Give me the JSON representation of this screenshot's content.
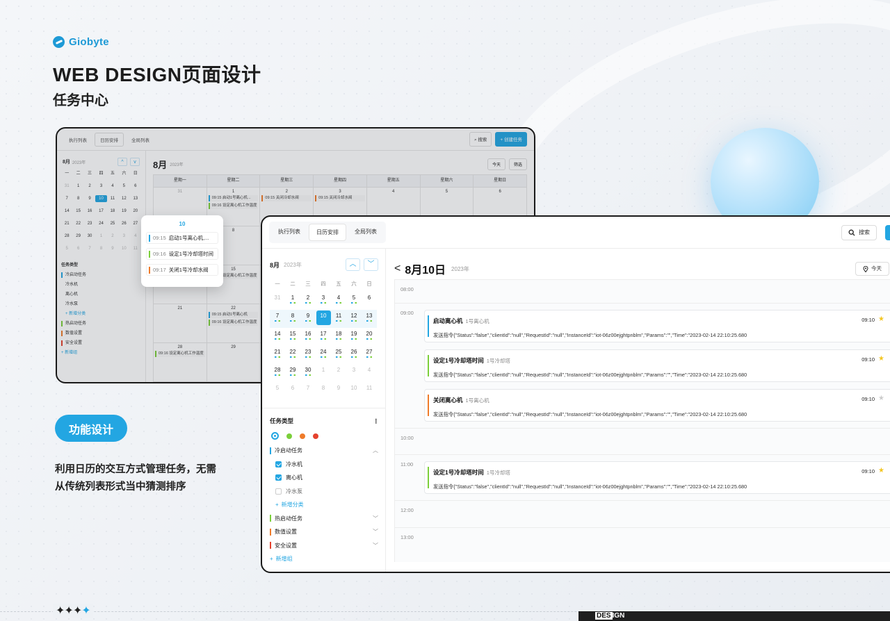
{
  "brand": {
    "name": "Giobyte"
  },
  "header": {
    "title": "WEB DESIGN页面设计",
    "subtitle": "任务中心"
  },
  "feature": {
    "pill": "功能设计",
    "description": "利用日历的交互方式管理任务，无需从传统列表形式当中猜测排序"
  },
  "footer": {
    "stars": "✦✦✦",
    "star_blue": "✦",
    "tag_a": "DES",
    "tag_b": "IGN"
  },
  "colors": {
    "accent": "#23a6e2",
    "green": "#7bcf3a",
    "orange": "#ef7b2a",
    "red": "#e5422e"
  },
  "back_window": {
    "tabs": [
      "执行列表",
      "日历安排",
      "全局列表"
    ],
    "search": "搜索",
    "create": "+ 创建任务",
    "mini": {
      "month": "8月",
      "year": "2023年"
    },
    "month_title": "8月",
    "year": "2023年",
    "today": "今天",
    "filter": "筛选",
    "weekdays_short": [
      "一",
      "二",
      "三",
      "四",
      "五",
      "六",
      "日"
    ],
    "weekdays_full": [
      "星期一",
      "星期二",
      "星期三",
      "星期四",
      "星期五",
      "星期六",
      "星期日"
    ],
    "task_types": {
      "title": "任务类型",
      "cold": "冷启动任务",
      "items": [
        "冷水机",
        "离心机",
        "冷水泵"
      ],
      "add_cat": "+ 新增分类",
      "hot": "热启动任务",
      "value": "数值设置",
      "safe": "安全设置",
      "add_group": "+ 新增组"
    },
    "cells": {
      "d31": "31",
      "d1": "1",
      "d2": "2",
      "d3": "3",
      "d4": "4",
      "d5": "5",
      "d6": "6",
      "d8": "8",
      "d15": "15",
      "d21": "21",
      "d22": "22",
      "d28": "28",
      "d29": "29"
    },
    "events": {
      "e1": "09:15 启动1号离心机...",
      "e2": "09:15 关闭冷却水阀",
      "e3": "09:15 关闭冷却水阀",
      "e4": "09:16 设定离心机工作温度",
      "e5": "09:16 设定离心机工作温度",
      "e6": "09:15 启动1号离心机",
      "e7": "09:16 设定离心机工作温度",
      "e8": "09:16 设定离心机工作温度"
    }
  },
  "popover": {
    "day": "10",
    "items": [
      {
        "time": "09:15",
        "text": "启动1号离心机,..."
      },
      {
        "time": "09:16",
        "text": "设定1号冷却塔时间"
      },
      {
        "time": "09:17",
        "text": "关闭1号冷却水阀"
      }
    ]
  },
  "front_window": {
    "tabs": [
      "执行列表",
      "日历安排",
      "全局列表"
    ],
    "search": "搜索",
    "add": "+",
    "mini_calendar": {
      "month": "8月",
      "year": "2023年",
      "prev": "^",
      "next": "v",
      "weekdays": [
        "一",
        "二",
        "三",
        "四",
        "五",
        "六",
        "日"
      ],
      "days": [
        [
          "31",
          "1",
          "2",
          "3",
          "4",
          "5",
          "6"
        ],
        [
          "7",
          "8",
          "9",
          "10",
          "11",
          "12",
          "13"
        ],
        [
          "14",
          "15",
          "16",
          "17",
          "18",
          "19",
          "20"
        ],
        [
          "21",
          "22",
          "23",
          "24",
          "25",
          "26",
          "27"
        ],
        [
          "28",
          "29",
          "30",
          "1",
          "2",
          "3",
          "4"
        ],
        [
          "5",
          "6",
          "7",
          "8",
          "9",
          "10",
          "11"
        ]
      ],
      "selected": "10"
    },
    "task_types": {
      "title": "任务类型",
      "menu": "⋮",
      "groups": [
        {
          "name": "冷启动任务",
          "color": "#23a6e2",
          "expanded": true
        },
        {
          "name": "热启动任务",
          "color": "#7bcf3a"
        },
        {
          "name": "数值设置",
          "color": "#ef7b2a"
        },
        {
          "name": "安全设置",
          "color": "#e5422e"
        }
      ],
      "children": [
        {
          "name": "冷水机",
          "checked": true
        },
        {
          "name": "离心机",
          "checked": true
        },
        {
          "name": "冷水泵",
          "checked": false
        }
      ],
      "add_category": "新增分类",
      "add_group": "新增组"
    },
    "day_view": {
      "back": "<",
      "title": "8月10日",
      "year": "2023年",
      "today": "今天",
      "slots": [
        "08:00",
        "09:00",
        "10:00",
        "11:00",
        "12:00",
        "13:00"
      ],
      "events": [
        {
          "title": "启动离心机",
          "device": "1号离心机",
          "time": "09:10",
          "command": "发送指令{\"Status\":\"false\",\"clientId\":\"null\",\"RequestId\":\"null\",\"InstanceId\":\"iot-06z00ejghtpnblm\",\"Params\":\"\",\"Time\":\"2023-02-14 22:10:25.680",
          "color": "#23a6e2",
          "starred": true
        },
        {
          "title": "设定1号冷却塔时间",
          "device": "1号冷却塔",
          "time": "09:10",
          "command": "发送指令{\"Status\":\"false\",\"clientId\":\"null\",\"RequestId\":\"null\",\"InstanceId\":\"iot-06z00ejghtpnblm\",\"Params\":\"\",\"Time\":\"2023-02-14 22:10:25.680",
          "color": "#7bcf3a",
          "starred": true
        },
        {
          "title": "关闭离心机",
          "device": "1号离心机",
          "time": "09:10",
          "command": "发送指令{\"Status\":\"false\",\"clientId\":\"null\",\"RequestId\":\"null\",\"InstanceId\":\"iot-06z00ejghtpnblm\",\"Params\":\"\",\"Time\":\"2023-02-14 22:10:25.680",
          "color": "#ef7b2a",
          "starred": false
        },
        {
          "title": "设定1号冷却塔时间",
          "device": "1号冷却塔",
          "time": "09:10",
          "command": "发送指令{\"Status\":\"false\",\"clientId\":\"null\",\"RequestId\":\"null\",\"InstanceId\":\"iot-06z00ejghtpnblm\",\"Params\":\"\",\"Time\":\"2023-02-14 22:10:25.680",
          "color": "#7bcf3a",
          "starred": true
        }
      ]
    }
  }
}
